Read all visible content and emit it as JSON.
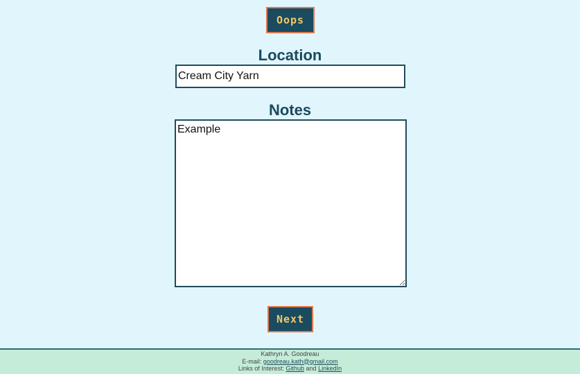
{
  "buttons": {
    "oops_label": "Oops",
    "next_label": "Next"
  },
  "form": {
    "location_label": "Location",
    "location_value": "Cream City Yarn",
    "notes_label": "Notes",
    "notes_value": "Example"
  },
  "footer": {
    "author": "Kathryn A. Goodreau",
    "email_prefix": "E-mail:",
    "email": "goodreau.kath@gmail.com",
    "links_prefix": "Links of Interest:",
    "link_github": "Github",
    "and_text": "and",
    "link_linkedin": "LinkedIn"
  },
  "colors": {
    "background": "#e1f5fd",
    "button_bg": "#1a4b5e",
    "button_border": "#e07a4f",
    "button_text": "#f2c86a",
    "heading": "#1a4b5e",
    "footer_bg": "#c4ecd9"
  }
}
